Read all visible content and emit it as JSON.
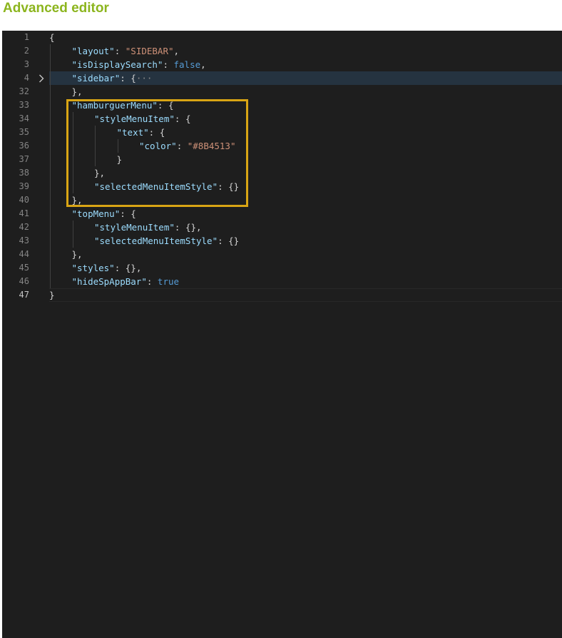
{
  "page": {
    "title": "Advanced editor"
  },
  "editor": {
    "current_line": "47",
    "lines": [
      {
        "n": "1",
        "indent": 0,
        "tokens": [
          {
            "t": "p",
            "v": "{"
          }
        ]
      },
      {
        "n": "2",
        "indent": 1,
        "tokens": [
          {
            "t": "k",
            "v": "\"layout\""
          },
          {
            "t": "p",
            "v": ": "
          },
          {
            "t": "s",
            "v": "\"SIDEBAR\""
          },
          {
            "t": "p",
            "v": ","
          }
        ]
      },
      {
        "n": "3",
        "indent": 1,
        "tokens": [
          {
            "t": "k",
            "v": "\"isDisplaySearch\""
          },
          {
            "t": "p",
            "v": ": "
          },
          {
            "t": "b",
            "v": "false"
          },
          {
            "t": "p",
            "v": ","
          }
        ]
      },
      {
        "n": "4",
        "indent": 1,
        "folded": true,
        "tokens": [
          {
            "t": "k",
            "v": "\"sidebar\""
          },
          {
            "t": "p",
            "v": ": {"
          },
          {
            "t": "e",
            "v": "···"
          }
        ]
      },
      {
        "n": "32",
        "indent": 1,
        "tokens": [
          {
            "t": "p",
            "v": "},"
          }
        ]
      },
      {
        "n": "33",
        "indent": 1,
        "tokens": [
          {
            "t": "k",
            "v": "\"hamburguerMenu\""
          },
          {
            "t": "p",
            "v": ": {"
          }
        ]
      },
      {
        "n": "34",
        "indent": 2,
        "tokens": [
          {
            "t": "k",
            "v": "\"styleMenuItem\""
          },
          {
            "t": "p",
            "v": ": {"
          }
        ]
      },
      {
        "n": "35",
        "indent": 3,
        "tokens": [
          {
            "t": "k",
            "v": "\"text\""
          },
          {
            "t": "p",
            "v": ": {"
          }
        ]
      },
      {
        "n": "36",
        "indent": 4,
        "tokens": [
          {
            "t": "k",
            "v": "\"color\""
          },
          {
            "t": "p",
            "v": ": "
          },
          {
            "t": "s",
            "v": "\"#8B4513\""
          }
        ]
      },
      {
        "n": "37",
        "indent": 3,
        "tokens": [
          {
            "t": "p",
            "v": "}"
          }
        ]
      },
      {
        "n": "38",
        "indent": 2,
        "tokens": [
          {
            "t": "p",
            "v": "},"
          }
        ]
      },
      {
        "n": "39",
        "indent": 2,
        "tokens": [
          {
            "t": "k",
            "v": "\"selectedMenuItemStyle\""
          },
          {
            "t": "p",
            "v": ": {}"
          }
        ]
      },
      {
        "n": "40",
        "indent": 1,
        "tokens": [
          {
            "t": "p",
            "v": "},"
          }
        ]
      },
      {
        "n": "41",
        "indent": 1,
        "tokens": [
          {
            "t": "k",
            "v": "\"topMenu\""
          },
          {
            "t": "p",
            "v": ": {"
          }
        ]
      },
      {
        "n": "42",
        "indent": 2,
        "tokens": [
          {
            "t": "k",
            "v": "\"styleMenuItem\""
          },
          {
            "t": "p",
            "v": ": {},"
          }
        ]
      },
      {
        "n": "43",
        "indent": 2,
        "tokens": [
          {
            "t": "k",
            "v": "\"selectedMenuItemStyle\""
          },
          {
            "t": "p",
            "v": ": {}"
          }
        ]
      },
      {
        "n": "44",
        "indent": 1,
        "tokens": [
          {
            "t": "p",
            "v": "},"
          }
        ]
      },
      {
        "n": "45",
        "indent": 1,
        "tokens": [
          {
            "t": "k",
            "v": "\"styles\""
          },
          {
            "t": "p",
            "v": ": {},"
          }
        ]
      },
      {
        "n": "46",
        "indent": 1,
        "tokens": [
          {
            "t": "k",
            "v": "\"hideSpAppBar\""
          },
          {
            "t": "p",
            "v": ": "
          },
          {
            "t": "b",
            "v": "true"
          }
        ]
      },
      {
        "n": "47",
        "indent": 0,
        "tokens": [
          {
            "t": "p",
            "v": "}"
          }
        ]
      }
    ]
  },
  "colors": {
    "title": "#8cb51e",
    "editor_bg": "#1e1e1e",
    "key": "#9cdcfe",
    "string": "#ce9178",
    "boolean": "#569cd6",
    "highlight_box": "#d9a514"
  },
  "icons": {
    "fold": "chevron-right-icon"
  }
}
